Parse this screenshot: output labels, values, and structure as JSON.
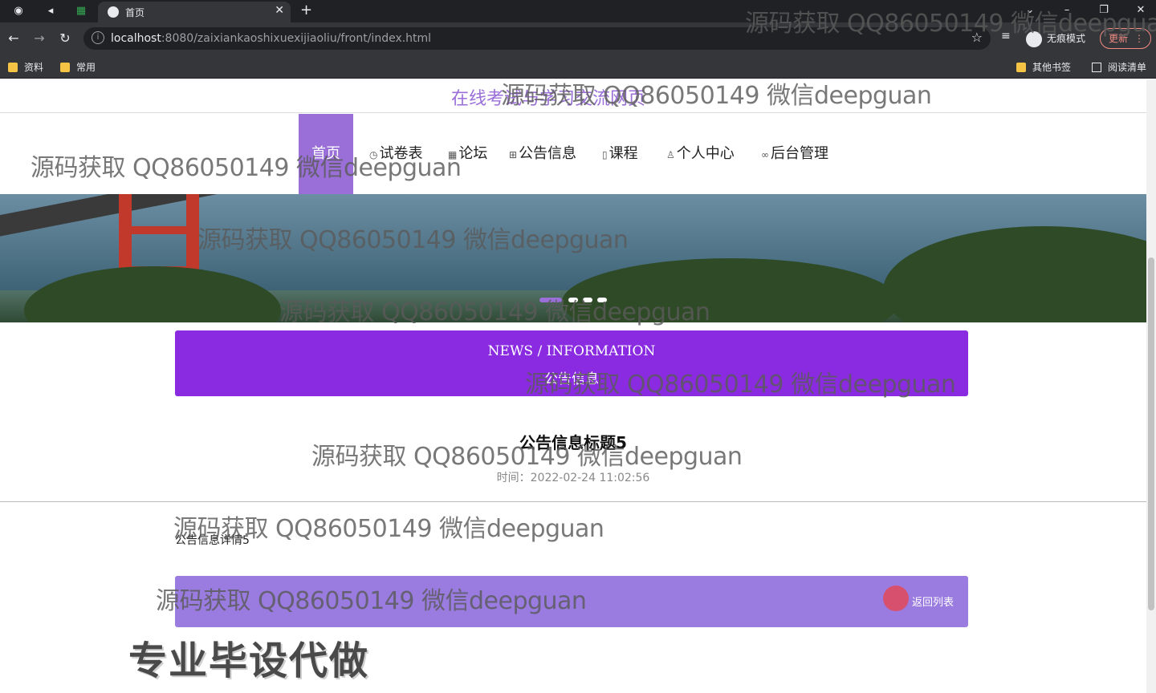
{
  "browser": {
    "tab_title": "首页",
    "url_host": "localhost",
    "url_rest": ":8080/zaixiankaoshixuexijiaoliu/front/index.html",
    "incognito_label": "无痕模式",
    "update_label": "更新",
    "bookmarks": [
      "资料",
      "常用"
    ],
    "bookmarks_right": [
      "其他书签",
      "阅读清单"
    ]
  },
  "site": {
    "title": "在线考试与学习交流网页",
    "nav": [
      {
        "label": "首页",
        "icon": "home-icon"
      },
      {
        "label": "试卷表",
        "icon": "clock-icon"
      },
      {
        "label": "论坛",
        "icon": "grid-icon"
      },
      {
        "label": "公告信息",
        "icon": "table-icon"
      },
      {
        "label": "课程",
        "icon": "book-icon"
      },
      {
        "label": "个人中心",
        "icon": "user-icon"
      },
      {
        "label": "后台管理",
        "icon": "link-icon"
      }
    ],
    "active_nav": "首页"
  },
  "news_header": {
    "english": "NEWS / INFORMATION",
    "chinese": "公告信息"
  },
  "article": {
    "title": "公告信息标题5",
    "time": "时间：2022-02-24 11:02:56",
    "body": "公告信息详情5"
  },
  "back_button": "返回列表",
  "watermarks": [
    "源码获取 QQ86050149 微信deepguan"
  ],
  "promo_text": "专业毕设代做",
  "colors": {
    "accent": "#9a6fd8",
    "news_bg": "#8a2be2",
    "back_bg": "#9a7be0"
  }
}
